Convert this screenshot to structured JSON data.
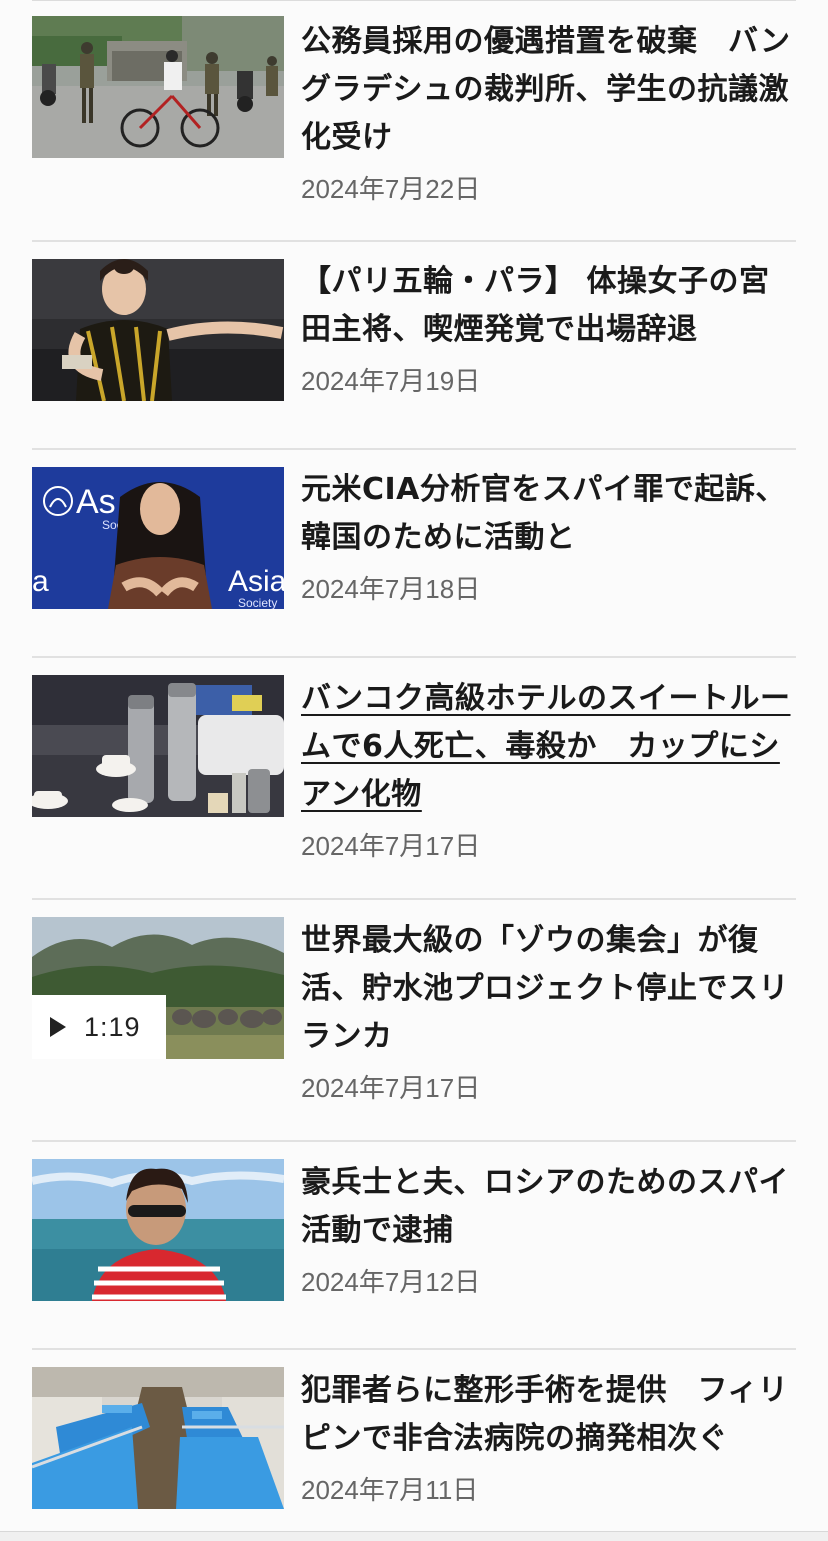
{
  "articles": [
    {
      "headline": "公務員採用の優遇措置を破棄　バングラデシュの裁判所、学生の抗議激化受け",
      "date": "2024年7月22日",
      "image_desc": "soldiers-street-cyclist"
    },
    {
      "headline": "【パリ五輪・パラ】 体操女子の宮田主将、喫煙発覚で出場辞退",
      "date": "2024年7月19日",
      "image_desc": "gymnast"
    },
    {
      "headline": "元米CIA分析官をスパイ罪で起訴、韓国のために活動と",
      "date": "2024年7月18日",
      "image_desc": "woman-speaker-asia-society",
      "image_text": "Asia",
      "image_subtext": "Society"
    },
    {
      "headline": "バンコク高級ホテルのスイートルームで6人死亡、毒殺か　カップにシアン化物",
      "date": "2024年7月17日",
      "image_desc": "hotel-room-tea-set"
    },
    {
      "headline": "世界最大級の「ゾウの集会」が復活、貯水池プロジェクト停止でスリランカ",
      "date": "2024年7月17日",
      "image_desc": "elephants-mountains",
      "video_duration": "1:19"
    },
    {
      "headline": "豪兵士と夫、ロシアのためのスパイ活動で逮捕",
      "date": "2024年7月12日",
      "image_desc": "woman-beach-selfie"
    },
    {
      "headline": "犯罪者らに整形手術を提供　フィリピンで非合法病院の摘発相次ぐ",
      "date": "2024年7月11日",
      "image_desc": "clinic-beds"
    }
  ],
  "colors": {
    "headline": "#1a1a1a",
    "date": "#666666",
    "divider": "#e1e1e1",
    "background": "#fbfbfb"
  },
  "icons": {
    "play": "play-icon"
  }
}
